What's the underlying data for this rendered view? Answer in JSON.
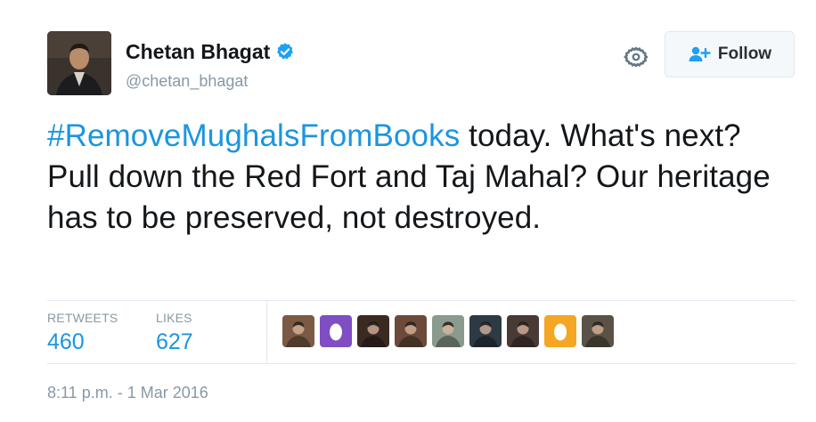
{
  "author": {
    "display_name": "Chetan Bhagat",
    "handle": "@chetan_bhagat",
    "verified": true,
    "avatar_icon": "profile-photo"
  },
  "actions": {
    "settings_icon": "gear-icon",
    "follow_label": "Follow",
    "follow_icon": "add-user-icon"
  },
  "tweet": {
    "hashtag": "#RemoveMughalsFromBooks",
    "text": " today. What's next? Pull down the Red Fort and Taj Mahal? Our heritage has to be preserved, not destroyed."
  },
  "stats": {
    "retweets_label": "RETWEETS",
    "retweets_value": "460",
    "likes_label": "LIKES",
    "likes_value": "627"
  },
  "likers": [
    {
      "kind": "photo",
      "color": "#7a5a44"
    },
    {
      "kind": "egg",
      "color": "#7e4ec2"
    },
    {
      "kind": "photo",
      "color": "#3b2a22"
    },
    {
      "kind": "photo",
      "color": "#6b4a3a"
    },
    {
      "kind": "photo",
      "color": "#8a9a8c"
    },
    {
      "kind": "photo",
      "color": "#2d3a44"
    },
    {
      "kind": "photo",
      "color": "#4a3a36"
    },
    {
      "kind": "egg",
      "color": "#f5a623"
    },
    {
      "kind": "photo",
      "color": "#5a5246"
    }
  ],
  "timestamp": "8:11 p.m. - 1 Mar 2016",
  "colors": {
    "link": "#1b95e0",
    "muted": "#8899a6",
    "border": "#e1e8ed",
    "verified": "#1da1f2"
  }
}
